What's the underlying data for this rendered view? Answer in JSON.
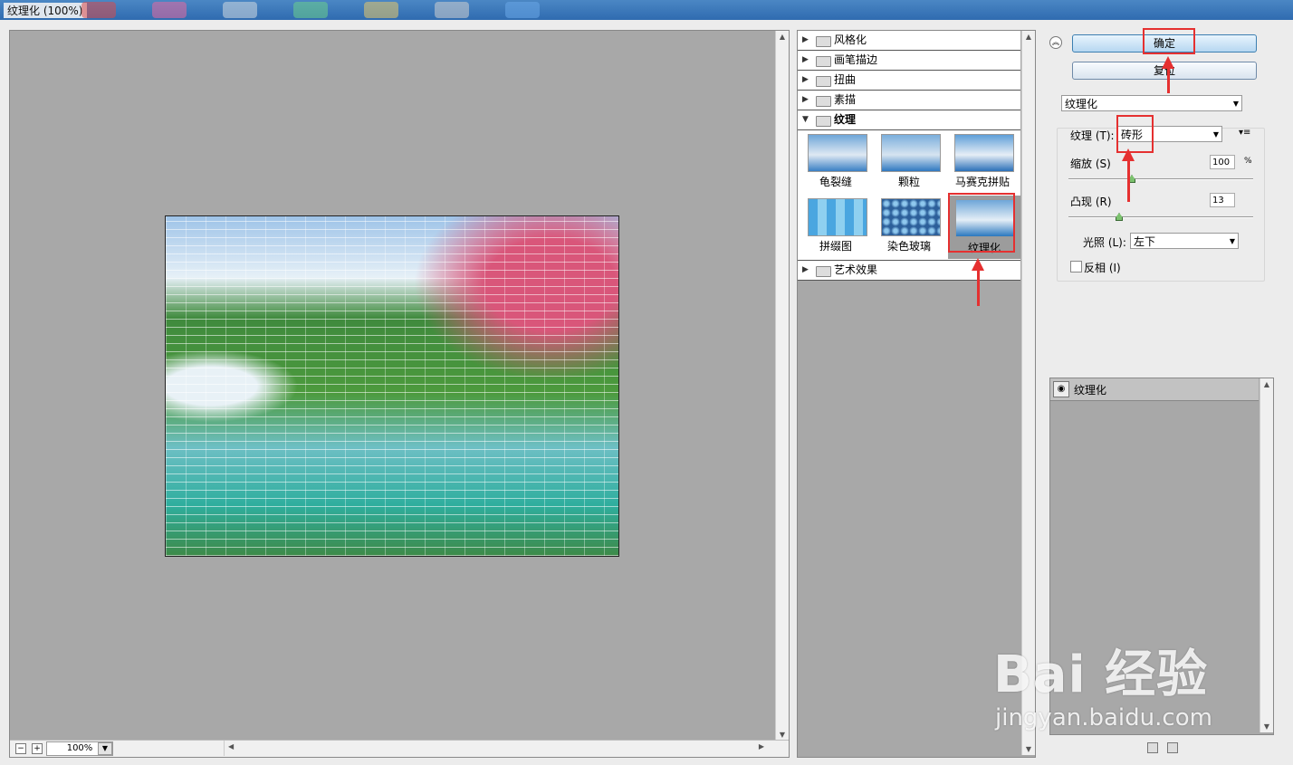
{
  "window": {
    "title": "纹理化 (100%)"
  },
  "preview": {
    "zoom": "100%",
    "zoom_out": "−",
    "zoom_in": "+"
  },
  "filters": {
    "categories": [
      "风格化",
      "画笔描边",
      "扭曲",
      "素描",
      "纹理",
      "艺术效果"
    ],
    "texture_items": [
      "龟裂缝",
      "颗粒",
      "马赛克拼贴",
      "拼缀图",
      "染色玻璃",
      "纹理化"
    ],
    "selected": "纹理化"
  },
  "settings": {
    "ok_label": "确定",
    "reset_label": "复位",
    "filter_select": "纹理化",
    "texture_label": "纹理 (T):",
    "texture_value": "砖形",
    "scale_label": "缩放 (S)",
    "scale_value": "100",
    "scale_unit": "%",
    "relief_label": "凸现 (R)",
    "relief_value": "13",
    "light_label": "光照 (L):",
    "light_value": "左下",
    "invert_label": "反相 (I)",
    "invert_checked": false
  },
  "layers": {
    "items": [
      "纹理化"
    ]
  },
  "watermark": {
    "main": "Bai 经验",
    "sub": "jingyan.baidu.com"
  },
  "colors": {
    "highlight": "#e53030",
    "panel": "#a8a8a8",
    "accent": "#3c7fb1"
  }
}
